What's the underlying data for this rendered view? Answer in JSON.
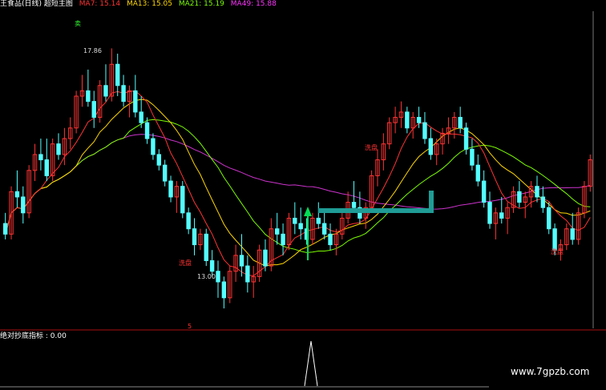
{
  "header": {
    "title": "王食品(日线) 超短主图",
    "ma_items": [
      {
        "label": "MA7: 15.14",
        "color": "#ff3333"
      },
      {
        "label": "MA13: 15.05",
        "color": "#ffd700"
      },
      {
        "label": "MA21: 15.19",
        "color": "#7cfc00"
      },
      {
        "label": "MA49: 15.88",
        "color": "#ff33ff"
      }
    ]
  },
  "sub_indicator": {
    "label": "绝对抄底指标 : 0.00"
  },
  "watermark": "www.7gpzb.com",
  "annotations": {
    "sell": "卖",
    "high_price": "17.86",
    "low_price": "13.00",
    "shake_1": "洗盘",
    "shake_2": "洗盘",
    "shake_3": "洗盘",
    "bottom_mark": "5"
  },
  "colors": {
    "up": "#ff3333",
    "down": "#54ffff",
    "ma7": "#ff3333",
    "ma13": "#ffd700",
    "ma21": "#7cfc00",
    "ma49": "#cc33cc",
    "signal_arrow": "#00dd55",
    "box_line": "#1f9c95"
  },
  "chart_data": {
    "type": "candlestick",
    "price_range": [
      12.7,
      18.6
    ],
    "candles": [
      [
        14.6,
        14.8,
        14.3,
        14.4
      ],
      [
        14.4,
        15.3,
        14.3,
        15.2
      ],
      [
        15.2,
        15.6,
        14.9,
        15.1
      ],
      [
        15.1,
        15.3,
        14.6,
        14.8
      ],
      [
        14.8,
        15.7,
        14.7,
        15.6
      ],
      [
        15.6,
        16.1,
        15.4,
        15.9
      ],
      [
        15.9,
        16.2,
        15.6,
        15.8
      ],
      [
        15.8,
        16.2,
        15.4,
        15.5
      ],
      [
        15.5,
        16.2,
        15.4,
        16.1
      ],
      [
        16.1,
        16.3,
        15.8,
        15.9
      ],
      [
        15.9,
        16.4,
        15.7,
        16.2
      ],
      [
        16.2,
        16.6,
        16.0,
        16.4
      ],
      [
        16.4,
        17.1,
        16.3,
        17.0
      ],
      [
        17.0,
        17.4,
        16.8,
        17.1
      ],
      [
        17.1,
        17.5,
        16.8,
        16.9
      ],
      [
        16.9,
        17.1,
        16.4,
        16.6
      ],
      [
        16.6,
        17.3,
        16.5,
        17.2
      ],
      [
        17.2,
        17.6,
        16.9,
        17.0
      ],
      [
        17.0,
        17.9,
        16.9,
        17.6
      ],
      [
        17.6,
        17.8,
        17.0,
        17.2
      ],
      [
        17.2,
        17.4,
        16.8,
        16.9
      ],
      [
        16.9,
        17.2,
        16.6,
        17.1
      ],
      [
        17.1,
        17.4,
        16.6,
        16.7
      ],
      [
        16.7,
        17.0,
        16.4,
        16.5
      ],
      [
        16.5,
        16.6,
        16.1,
        16.2
      ],
      [
        16.2,
        16.3,
        15.8,
        15.9
      ],
      [
        15.9,
        16.0,
        15.6,
        15.7
      ],
      [
        15.7,
        15.8,
        15.3,
        15.4
      ],
      [
        15.4,
        15.5,
        15.0,
        15.1
      ],
      [
        15.1,
        15.4,
        14.8,
        15.3
      ],
      [
        15.3,
        15.4,
        14.7,
        14.8
      ],
      [
        14.8,
        14.9,
        14.4,
        14.5
      ],
      [
        14.5,
        14.7,
        14.0,
        14.2
      ],
      [
        14.2,
        14.5,
        14.1,
        14.4
      ],
      [
        14.4,
        14.5,
        13.8,
        13.9
      ],
      [
        13.9,
        14.1,
        13.6,
        13.7
      ],
      [
        13.7,
        13.9,
        13.2,
        13.5
      ],
      [
        13.5,
        13.6,
        13.0,
        13.2
      ],
      [
        13.2,
        13.8,
        13.1,
        13.7
      ],
      [
        13.7,
        14.2,
        13.5,
        14.0
      ],
      [
        14.0,
        14.4,
        13.6,
        13.8
      ],
      [
        13.8,
        14.0,
        13.3,
        13.5
      ],
      [
        13.5,
        13.8,
        13.2,
        13.6
      ],
      [
        13.6,
        14.2,
        13.5,
        14.1
      ],
      [
        14.1,
        14.3,
        13.7,
        13.8
      ],
      [
        13.8,
        14.7,
        13.7,
        14.5
      ],
      [
        14.5,
        14.8,
        14.2,
        14.4
      ],
      [
        14.4,
        14.6,
        14.0,
        14.2
      ],
      [
        14.2,
        14.8,
        14.1,
        14.7
      ],
      [
        14.7,
        15.0,
        14.4,
        14.6
      ],
      [
        14.6,
        14.9,
        14.3,
        14.5
      ],
      [
        14.5,
        14.7,
        14.2,
        14.3
      ],
      [
        14.3,
        14.8,
        14.2,
        14.7
      ],
      [
        14.7,
        15.0,
        14.5,
        14.6
      ],
      [
        14.6,
        14.8,
        14.3,
        14.4
      ],
      [
        14.4,
        14.6,
        14.1,
        14.2
      ],
      [
        14.2,
        14.5,
        14.0,
        14.4
      ],
      [
        14.4,
        14.8,
        14.3,
        14.7
      ],
      [
        14.7,
        15.2,
        14.6,
        15.0
      ],
      [
        15.0,
        15.4,
        14.8,
        14.9
      ],
      [
        14.9,
        15.2,
        14.6,
        14.7
      ],
      [
        14.7,
        15.0,
        14.5,
        14.9
      ],
      [
        14.9,
        15.6,
        14.8,
        15.5
      ],
      [
        15.5,
        16.0,
        15.3,
        15.8
      ],
      [
        15.8,
        16.3,
        15.6,
        16.1
      ],
      [
        16.1,
        16.6,
        16.0,
        16.5
      ],
      [
        16.5,
        16.8,
        16.3,
        16.6
      ],
      [
        16.6,
        16.9,
        16.4,
        16.7
      ],
      [
        16.7,
        16.8,
        16.3,
        16.4
      ],
      [
        16.4,
        16.7,
        16.2,
        16.6
      ],
      [
        16.6,
        16.8,
        16.4,
        16.5
      ],
      [
        16.5,
        16.7,
        16.1,
        16.2
      ],
      [
        16.2,
        16.4,
        15.8,
        15.9
      ],
      [
        15.9,
        16.2,
        15.7,
        16.1
      ],
      [
        16.1,
        16.4,
        15.9,
        16.3
      ],
      [
        16.3,
        16.6,
        16.1,
        16.4
      ],
      [
        16.4,
        16.7,
        16.2,
        16.6
      ],
      [
        16.6,
        16.8,
        16.3,
        16.4
      ],
      [
        16.4,
        16.5,
        15.9,
        16.0
      ],
      [
        16.0,
        16.2,
        15.6,
        15.7
      ],
      [
        15.7,
        15.9,
        15.3,
        15.4
      ],
      [
        15.4,
        15.6,
        14.9,
        15.0
      ],
      [
        15.0,
        15.2,
        14.5,
        14.6
      ],
      [
        14.6,
        14.9,
        14.3,
        14.8
      ],
      [
        14.8,
        15.1,
        14.6,
        14.7
      ],
      [
        14.7,
        15.0,
        14.4,
        14.9
      ],
      [
        14.9,
        15.3,
        14.8,
        15.2
      ],
      [
        15.2,
        15.4,
        14.9,
        15.0
      ],
      [
        15.0,
        15.2,
        14.7,
        15.1
      ],
      [
        15.1,
        15.4,
        14.9,
        15.3
      ],
      [
        15.3,
        15.5,
        15.0,
        15.1
      ],
      [
        15.1,
        15.3,
        14.8,
        14.9
      ],
      [
        14.9,
        15.0,
        14.4,
        14.5
      ],
      [
        14.5,
        14.6,
        14.0,
        14.1
      ],
      [
        14.1,
        14.3,
        13.9,
        14.2
      ],
      [
        14.2,
        14.6,
        14.1,
        14.5
      ],
      [
        14.5,
        14.8,
        14.2,
        14.3
      ],
      [
        14.3,
        14.9,
        14.2,
        14.8
      ],
      [
        14.8,
        15.4,
        14.7,
        15.3
      ],
      [
        15.3,
        15.9,
        15.2,
        15.8
      ]
    ]
  }
}
